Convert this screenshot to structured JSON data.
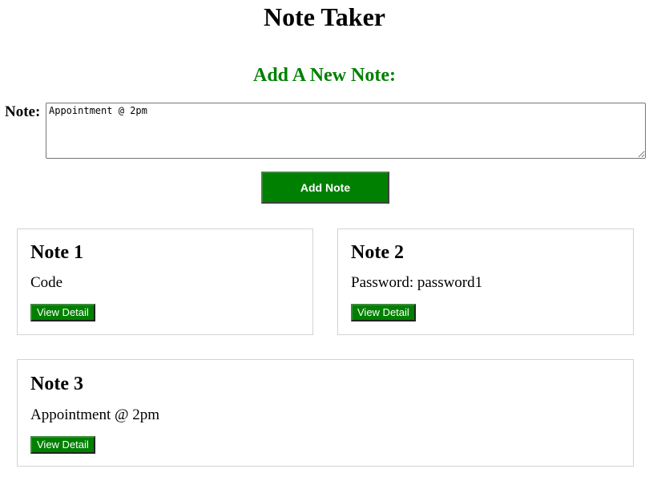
{
  "app": {
    "title": "Note Taker"
  },
  "form": {
    "heading": "Add A New Note:",
    "label": "Note:",
    "input_value": "Appointment @ 2pm",
    "add_button_label": "Add Note"
  },
  "notes": [
    {
      "title": "Note 1",
      "text": "Code",
      "button_label": "View Detail"
    },
    {
      "title": "Note 2",
      "text": "Password: password1",
      "button_label": "View Detail"
    },
    {
      "title": "Note 3",
      "text": "Appointment @ 2pm",
      "button_label": "View Detail"
    }
  ],
  "colors": {
    "accent": "#008000",
    "card_border": "#d3d3d3",
    "text": "#000000",
    "background": "#ffffff"
  }
}
